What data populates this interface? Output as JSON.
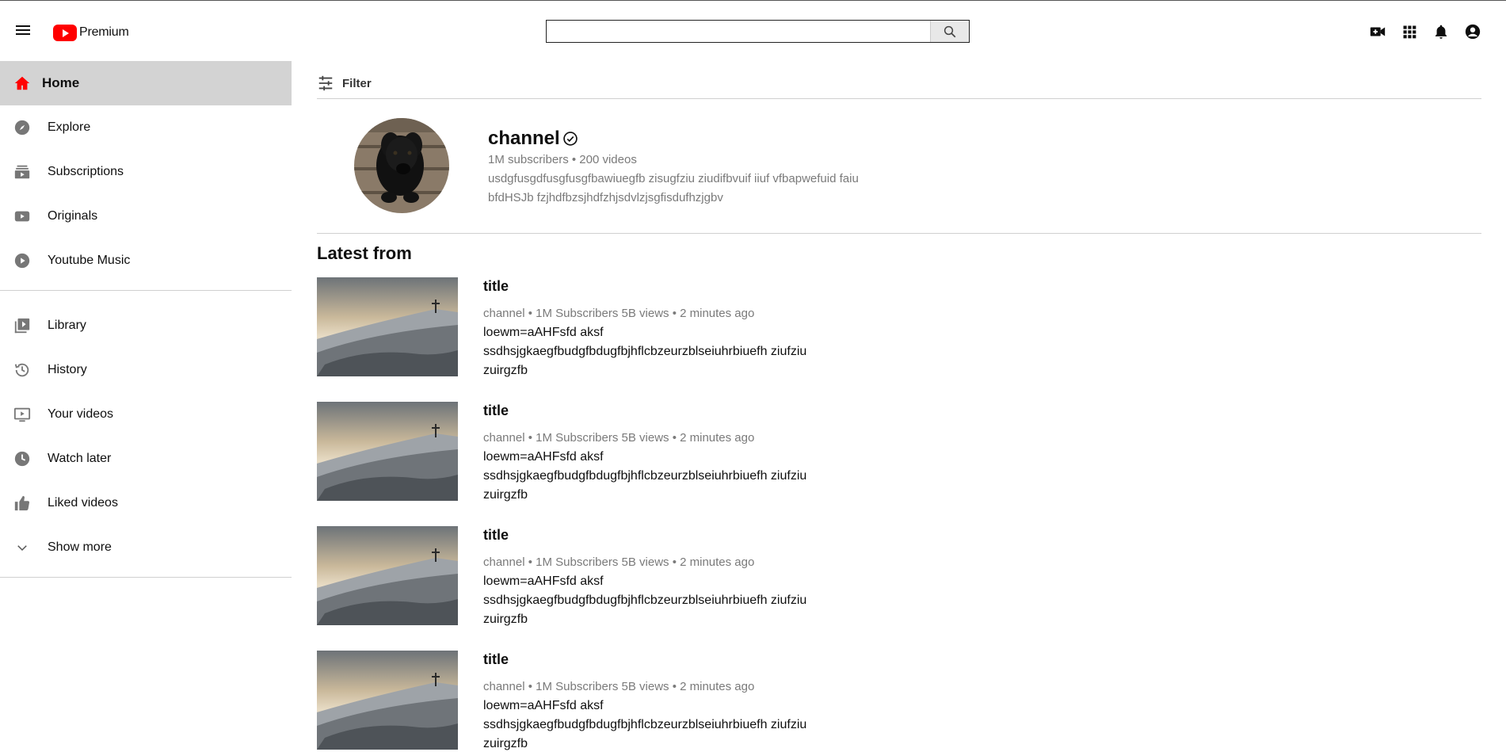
{
  "header": {
    "logo_text": "Premium",
    "search": {
      "value": "",
      "placeholder": ""
    },
    "icons": [
      "create-video-icon",
      "apps-grid-icon",
      "notifications-bell-icon",
      "account-icon"
    ]
  },
  "sidebar": {
    "primary": [
      {
        "label": "Home",
        "icon": "home-icon",
        "active": true
      },
      {
        "label": "Explore",
        "icon": "compass-icon"
      },
      {
        "label": "Subscriptions",
        "icon": "subscriptions-icon"
      },
      {
        "label": "Originals",
        "icon": "play-box-icon"
      },
      {
        "label": "Youtube Music",
        "icon": "music-play-icon"
      }
    ],
    "secondary": [
      {
        "label": "Library",
        "icon": "library-icon"
      },
      {
        "label": "History",
        "icon": "history-icon"
      },
      {
        "label": "Your videos",
        "icon": "your-videos-icon"
      },
      {
        "label": "Watch later",
        "icon": "clock-icon"
      },
      {
        "label": "Liked videos",
        "icon": "thumbs-up-icon"
      },
      {
        "label": "Show more",
        "icon": "chevron-down-icon"
      }
    ]
  },
  "main": {
    "filter_label": "Filter",
    "channel": {
      "name": "channel",
      "stats": "1M subscribers • 200 videos",
      "description": "usdgfusgdfusgfusgfbawiuegfb zisugfziu ziudifbvuif iiuf vfbapwefuid faiu bfdHSJb fzjhdfbzsjhdfzhjsdvlzjsgfisdufhzjgbv"
    },
    "section_title": "Latest from",
    "videos": [
      {
        "title": "title",
        "meta": "channel • 1M Subscribers 5B views • 2 minutes ago",
        "description": "loewm=aAHFsfd aksf ssdhsjgkaegfbudgfbdugfbjhflcbzeurzblseiuhrbiuefh ziufziu zuirgzfb"
      },
      {
        "title": "title",
        "meta": "channel • 1M Subscribers 5B views • 2 minutes ago",
        "description": "loewm=aAHFsfd aksf ssdhsjgkaegfbudgfbdugfbjhflcbzeurzblseiuhrbiuefh ziufziu zuirgzfb"
      },
      {
        "title": "title",
        "meta": "channel • 1M Subscribers 5B views • 2 minutes ago",
        "description": "loewm=aAHFsfd aksf ssdhsjgkaegfbudgfbdugfbjhflcbzeurzblseiuhrbiuefh ziufziu zuirgzfb"
      },
      {
        "title": "title",
        "meta": "channel • 1M Subscribers 5B views • 2 minutes ago",
        "description": "loewm=aAHFsfd aksf ssdhsjgkaegfbudgfbdugfbjhflcbzeurzblseiuhrbiuefh ziufziu zuirgzfb"
      }
    ]
  },
  "colors": {
    "brand_red": "#ff0000",
    "active_bg": "#d3d3d3",
    "muted_text": "#7a7a7a"
  }
}
